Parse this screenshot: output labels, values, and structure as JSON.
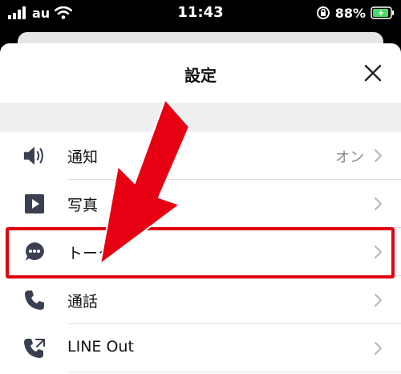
{
  "status_bar": {
    "carrier": "au",
    "time": "11:43",
    "battery": "88%"
  },
  "settings": {
    "title": "設定",
    "items": [
      {
        "label": "通知",
        "value": "オン",
        "icon": "speaker-icon"
      },
      {
        "label": "写真",
        "value": "",
        "icon": "play-icon"
      },
      {
        "label": "トーク",
        "value": "",
        "icon": "chat-bubble-icon"
      },
      {
        "label": "通話",
        "value": "",
        "icon": "phone-icon"
      },
      {
        "label": "LINE Out",
        "value": "",
        "icon": "line-out-phone-icon"
      }
    ]
  },
  "colors": {
    "highlight": "#e00010",
    "icon": "#3a3f52",
    "chevron": "#b8b8b8"
  }
}
